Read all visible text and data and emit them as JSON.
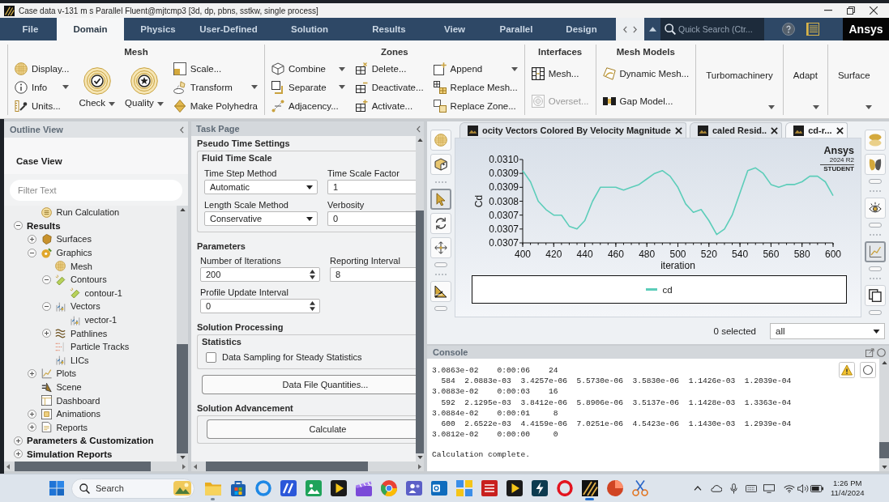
{
  "window": {
    "title": "Case data v-131 m s Parallel Fluent@mjtcmp3 [3d, dp, pbns, sstkw, single process]"
  },
  "menu_tabs": [
    {
      "label": "File",
      "selected": false
    },
    {
      "label": "Domain",
      "selected": true
    },
    {
      "label": "Physics",
      "selected": false
    },
    {
      "label": "User-Defined",
      "selected": false
    },
    {
      "label": "Solution",
      "selected": false
    },
    {
      "label": "Results",
      "selected": false
    },
    {
      "label": "View",
      "selected": false
    },
    {
      "label": "Parallel",
      "selected": false
    },
    {
      "label": "Design",
      "selected": false
    }
  ],
  "quick_search": {
    "placeholder": "Quick Search (Ctr..."
  },
  "brand": "Ansys",
  "ribbon": {
    "groups": [
      {
        "kind": "panel",
        "title": "Mesh",
        "columns": [
          {
            "kind": "stack",
            "items": [
              {
                "label": "Display...",
                "kind": "display",
                "dropdown": false,
                "disabled": false
              },
              {
                "label": "Info",
                "kind": "info",
                "dropdown": true,
                "disabled": false
              },
              {
                "label": "Units...",
                "kind": "units",
                "dropdown": false,
                "disabled": false
              }
            ]
          },
          {
            "kind": "large",
            "items": [
              {
                "label": "Check",
                "kind": "check",
                "dropdown": true,
                "disabled": false
              }
            ]
          },
          {
            "kind": "large",
            "items": [
              {
                "label": "Quality",
                "kind": "quality",
                "dropdown": true,
                "disabled": false
              }
            ]
          },
          {
            "kind": "stack",
            "items": [
              {
                "label": "Scale...",
                "kind": "scale",
                "dropdown": false,
                "disabled": false
              },
              {
                "label": "Transform",
                "kind": "transform",
                "dropdown": true,
                "disabled": false
              },
              {
                "label": "Make Polyhedra",
                "kind": "polyhedra",
                "dropdown": false,
                "disabled": false
              }
            ]
          }
        ]
      },
      {
        "kind": "panel",
        "title": "Zones",
        "columns": [
          {
            "kind": "stack",
            "items": [
              {
                "label": "Combine",
                "kind": "combine",
                "dropdown": true,
                "disabled": false
              },
              {
                "label": "Separate",
                "kind": "separate",
                "dropdown": true,
                "disabled": false
              },
              {
                "label": "Adjacency...",
                "kind": "adjacency",
                "dropdown": false,
                "disabled": false
              }
            ]
          },
          {
            "kind": "stack",
            "items": [
              {
                "label": "Delete...",
                "kind": "delete",
                "dropdown": false,
                "disabled": false
              },
              {
                "label": "Deactivate...",
                "kind": "deactivate",
                "dropdown": false,
                "disabled": false
              },
              {
                "label": "Activate...",
                "kind": "activate",
                "dropdown": false,
                "disabled": false
              }
            ]
          },
          {
            "kind": "stack",
            "items": [
              {
                "label": "Append",
                "kind": "append",
                "dropdown": true,
                "disabled": false
              },
              {
                "label": "Replace Mesh...",
                "kind": "replace_mesh",
                "dropdown": false,
                "disabled": false
              },
              {
                "label": "Replace Zone...",
                "kind": "replace_zone",
                "dropdown": false,
                "disabled": false
              }
            ]
          }
        ]
      },
      {
        "kind": "panel",
        "title": "Interfaces",
        "columns": [
          {
            "kind": "stack",
            "items": [
              {
                "label": "Mesh...",
                "kind": "interface",
                "dropdown": false,
                "disabled": false
              },
              {
                "label": "Overset...",
                "kind": "overset",
                "dropdown": false,
                "disabled": true
              }
            ]
          }
        ]
      },
      {
        "kind": "panel",
        "title": "Mesh Models",
        "columns": [
          {
            "kind": "stack",
            "items": [
              {
                "label": "Dynamic Mesh...",
                "kind": "dynamic",
                "dropdown": false,
                "disabled": false
              },
              {
                "label": "Gap Model...",
                "kind": "gap",
                "dropdown": false,
                "disabled": false
              }
            ]
          }
        ]
      },
      {
        "kind": "collapsed",
        "label": "Turbomachinery"
      },
      {
        "kind": "collapsed",
        "label": "Adapt"
      },
      {
        "kind": "collapsed",
        "label": "Surface"
      }
    ]
  },
  "outline": {
    "title": "Outline View",
    "section": "Case View",
    "filter": {
      "placeholder": "Filter Text"
    },
    "tree": {
      "partial_branch": [
        {
          "label": "Run Calculation",
          "kind": "calculation"
        }
      ],
      "items": [
        {
          "label": "Results",
          "kind": "section",
          "expanded": true,
          "children": [
            {
              "label": "Surfaces",
              "kind": "surface",
              "expanded": false
            },
            {
              "label": "Graphics",
              "kind": "graphics",
              "expanded": true,
              "children": [
                {
                  "label": "Mesh",
                  "kind": "mesh"
                },
                {
                  "label": "Contours",
                  "kind": "contour",
                  "expanded": true,
                  "children": [
                    {
                      "label": "contour-1",
                      "kind": "contour"
                    }
                  ]
                },
                {
                  "label": "Vectors",
                  "kind": "vector",
                  "expanded": true,
                  "children": [
                    {
                      "label": "vector-1",
                      "kind": "vector"
                    }
                  ]
                },
                {
                  "label": "Pathlines",
                  "kind": "pathline",
                  "expanded": false
                },
                {
                  "label": "Particle Tracks",
                  "kind": "particles"
                },
                {
                  "label": "LICs",
                  "kind": "vector"
                }
              ]
            },
            {
              "label": "Plots",
              "kind": "plot",
              "expanded": false
            },
            {
              "label": "Scene",
              "kind": "scene"
            },
            {
              "label": "Dashboard",
              "kind": "dashboard"
            },
            {
              "label": "Animations",
              "kind": "animation",
              "expanded": false
            },
            {
              "label": "Reports",
              "kind": "report",
              "expanded": false
            }
          ]
        },
        {
          "label": "Parameters & Customization",
          "kind": "section",
          "expanded": false
        },
        {
          "label": "Simulation Reports",
          "kind": "section",
          "expanded": false
        }
      ]
    }
  },
  "task_page": {
    "title": "Task Page",
    "sections": [
      {
        "title": "Pseudo Time Settings",
        "blocks": [
          {
            "kind": "group",
            "title": "Fluid Time Scale",
            "blocks": [
              {
                "kind": "fields",
                "fields": [
                  {
                    "label": "Time Step Method",
                    "kind": "dropdown",
                    "value": "Automatic"
                  },
                  {
                    "label": "Time Scale Factor",
                    "kind": "text",
                    "value": "1"
                  },
                  {
                    "label": "Length Scale Method",
                    "kind": "dropdown",
                    "value": "Conservative"
                  },
                  {
                    "label": "Verbosity",
                    "kind": "text",
                    "value": "0"
                  }
                ]
              }
            ]
          }
        ]
      },
      {
        "title": "Parameters",
        "blocks": [
          {
            "kind": "fields",
            "fields": [
              {
                "label": "Number of Iterations",
                "kind": "spinner",
                "value": "200"
              },
              {
                "label": "Reporting Interval",
                "kind": "text",
                "value": "8"
              },
              {
                "label": "Profile Update Interval",
                "kind": "spinner",
                "value": "0"
              }
            ]
          }
        ]
      },
      {
        "title": "Solution Processing",
        "blocks": [
          {
            "kind": "group",
            "title": "Statistics",
            "blocks": [
              {
                "kind": "checkbox",
                "label": "Data Sampling for Steady Statistics",
                "checked": false
              }
            ]
          },
          {
            "kind": "button",
            "label": "Data File Quantities..."
          }
        ]
      },
      {
        "title": "Solution Advancement",
        "blocks": [
          {
            "kind": "group",
            "blocks": [
              {
                "kind": "button",
                "label": "Calculate"
              }
            ]
          }
        ]
      }
    ]
  },
  "graphics": {
    "left_toolbar": [
      {
        "handle": false,
        "tools": [
          {
            "kind": "display",
            "selected": false
          },
          {
            "kind": "view",
            "selected": false
          }
        ]
      },
      {
        "handle": true,
        "tools": [
          {
            "kind": "pointer",
            "selected": true
          },
          {
            "kind": "rotate",
            "selected": false
          },
          {
            "kind": "move",
            "selected": false
          }
        ]
      },
      {
        "handle": true,
        "tools": [
          {
            "kind": "clip",
            "selected": false
          }
        ]
      }
    ],
    "right_toolbar": [
      {
        "handle": true,
        "tools": [
          {
            "kind": "layers",
            "selected": false
          },
          {
            "kind": "shapes",
            "selected": false
          }
        ]
      },
      {
        "handle": true,
        "tools": [
          {
            "kind": "eye",
            "selected": false
          }
        ]
      },
      {
        "handle": true,
        "tools": [
          {
            "kind": "chart",
            "selected": true
          }
        ]
      },
      {
        "handle": true,
        "tools": [
          {
            "kind": "copy",
            "selected": false
          }
        ]
      }
    ],
    "tabs": [
      {
        "label": "ocity Vectors Colored By Velocity Magnitude",
        "selected": false
      },
      {
        "label": "caled Resid..",
        "selected": false
      },
      {
        "label": "cd-r...",
        "selected": true
      }
    ],
    "product_logo": {
      "name": "Ansys",
      "version": "2024 R2",
      "edition": "STUDENT"
    },
    "chart_data": [
      {
        "type": "line",
        "xlabel": "iteration",
        "ylabel": "Cd",
        "legend": "bottom",
        "xlim": [
          400,
          600
        ],
        "ylim": [
          0.03065,
          0.03095
        ],
        "xticks": [
          400,
          420,
          440,
          460,
          480,
          500,
          520,
          540,
          560,
          580,
          600
        ],
        "yticks": [
          {
            "value": 0.03065,
            "label": "0.0307"
          },
          {
            "value": 0.0307,
            "label": "0.0307"
          },
          {
            "value": 0.03075,
            "label": "0.0307"
          },
          {
            "value": 0.0308,
            "label": "0.0308"
          },
          {
            "value": 0.03085,
            "label": "0.0309"
          },
          {
            "value": 0.0309,
            "label": "0.0309"
          },
          {
            "value": 0.03095,
            "label": "0.0310"
          }
        ],
        "x": [
          400,
          405,
          410,
          415,
          420,
          425,
          430,
          435,
          440,
          445,
          450,
          455,
          460,
          465,
          470,
          475,
          480,
          485,
          490,
          495,
          500,
          505,
          510,
          515,
          520,
          525,
          530,
          535,
          540,
          545,
          550,
          555,
          560,
          565,
          570,
          575,
          580,
          585,
          590,
          595,
          600
        ],
        "series": [
          {
            "name": "cd",
            "color": "#5ccdb9",
            "values": [
              0.03091,
              0.03087,
              0.0308,
              0.03077,
              0.03075,
              0.03075,
              0.03071,
              0.0307,
              0.03073,
              0.0308,
              0.03085,
              0.03085,
              0.03085,
              0.03084,
              0.03085,
              0.03086,
              0.03088,
              0.0309,
              0.03091,
              0.03089,
              0.03085,
              0.03079,
              0.03076,
              0.03077,
              0.03073,
              0.03068,
              0.0307,
              0.03075,
              0.03083,
              0.03091,
              0.03092,
              0.0309,
              0.03086,
              0.03085,
              0.03086,
              0.03086,
              0.03087,
              0.03089,
              0.03089,
              0.03087,
              0.03082
            ]
          }
        ]
      }
    ],
    "selection": {
      "count": "0 selected",
      "filter": "all"
    }
  },
  "console": {
    "title": "Console",
    "output_lines": [
      "3.0863e-02    0:00:06    24",
      "  584  2.0883e-03  3.4257e-06  5.5730e-06  3.5830e-06  1.1426e-03  1.2039e-04",
      "3.0883e-02    0:00:03    16",
      "  592  2.1295e-03  3.8412e-06  5.8906e-06  3.5137e-06  1.1428e-03  1.3363e-04",
      "3.0884e-02    0:00:01     8",
      "  600  2.6522e-03  4.4159e-06  7.0251e-06  4.5423e-06  1.1430e-03  1.2939e-04",
      "3.0812e-02    0:00:00     0"
    ],
    "status_line": "Calculation complete."
  },
  "taskbar": {
    "search": {
      "placeholder": "Search"
    },
    "apps": [
      {
        "kind": "folder",
        "running": true,
        "selected": false
      },
      {
        "kind": "bag",
        "running": false,
        "selected": false
      },
      {
        "kind": "ring",
        "running": false,
        "selected": false
      },
      {
        "kind": "slash",
        "running": false,
        "selected": false
      },
      {
        "kind": "gallery",
        "running": false,
        "selected": false
      },
      {
        "kind": "player",
        "running": false,
        "selected": false
      },
      {
        "kind": "clapper",
        "running": false,
        "selected": false
      },
      {
        "kind": "browser",
        "running": false,
        "selected": false
      },
      {
        "kind": "people",
        "running": false,
        "selected": false
      },
      {
        "kind": "mail",
        "running": false,
        "selected": false
      },
      {
        "kind": "squares",
        "running": false,
        "selected": false
      },
      {
        "kind": "striped",
        "running": false,
        "selected": false
      },
      {
        "kind": "player",
        "running": false,
        "selected": false
      },
      {
        "kind": "bolt",
        "running": false,
        "selected": false
      },
      {
        "kind": "redring",
        "running": false,
        "selected": false
      },
      {
        "kind": "stripes",
        "running": true,
        "selected": true
      },
      {
        "kind": "disc",
        "running": false,
        "selected": false
      },
      {
        "kind": "scissors",
        "running": false,
        "selected": false
      }
    ],
    "clock": {
      "time": "1:26 PM",
      "date": "11/4/2024"
    }
  }
}
